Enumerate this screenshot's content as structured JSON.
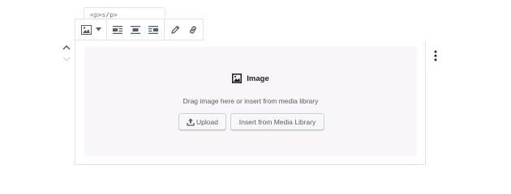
{
  "breadcrumb": {
    "text": "<p>s/p>"
  },
  "toolbar": {
    "icons": [
      "image-icon",
      "chevron-down-icon",
      "align-left-icon",
      "align-center-icon",
      "align-right-icon",
      "pencil-icon",
      "link-icon"
    ]
  },
  "placeholder": {
    "title": "Image",
    "instructions": "Drag image here or insert from media library",
    "upload_label": "Upload",
    "library_label": "Insert from Media Library"
  },
  "colors": {
    "placeholder_bg": "#f8f6f9",
    "border": "#e2e4e7",
    "icon": "#555d66"
  }
}
